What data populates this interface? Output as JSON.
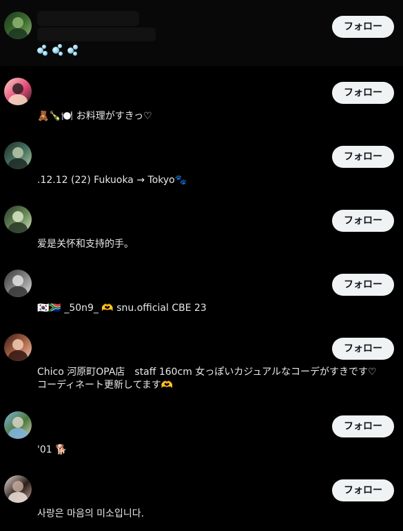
{
  "follow_label": "フォロー",
  "users": [
    {
      "bio": "",
      "icons": [
        "bubbles-icon"
      ],
      "avatar_colors": [
        "#1c3a22",
        "#3f6b2e",
        "#8fb572"
      ]
    },
    {
      "bio": "🧸🍾🍽️ お料理がすきっ♡",
      "avatar_colors": [
        "#f5d3c0",
        "#e64a7b",
        "#2a1e1e"
      ]
    },
    {
      "bio": ".12.12 (22) Fukuoka → Tokyo🐾",
      "avatar_colors": [
        "#1f2e28",
        "#4a7562",
        "#b8c9a8"
      ]
    },
    {
      "bio": "爱是关怀和支持的手。",
      "avatar_colors": [
        "#2b3b2a",
        "#6a8a5a",
        "#d9e6c6"
      ]
    },
    {
      "bio": "🇰🇷🇿🇦 _50n9_ 🫶 snu.official CBE 23",
      "avatar_colors": [
        "#3a3a3a",
        "#8a8a8a",
        "#e0e0e0"
      ]
    },
    {
      "bio": "Chico 河原町OPA店　staff 160cm 女っぽいカジュアルなコーデがすきです♡\nコーディネート更新してます🫶",
      "avatar_colors": [
        "#3a1b14",
        "#b06a4c",
        "#f2cbb6"
      ]
    },
    {
      "bio": "'01 🐕",
      "avatar_colors": [
        "#7fb2d9",
        "#4c7a3a",
        "#d8d4c4"
      ]
    },
    {
      "bio": "사랑은 마음의 미소입니다.",
      "avatar_colors": [
        "#e8dcd6",
        "#2a1e1a",
        "#c7a89a"
      ]
    }
  ]
}
